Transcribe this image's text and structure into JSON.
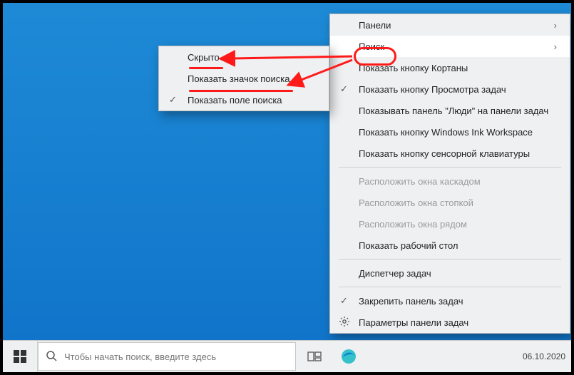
{
  "taskbar": {
    "search_placeholder": "Чтобы начать поиск, введите здесь",
    "date": "06.10.2020"
  },
  "main_menu": {
    "items": [
      {
        "label": "Панели",
        "arrow": true
      },
      {
        "label": "Поиск",
        "arrow": true,
        "hover": true
      },
      {
        "label": "Показать кнопку Кортаны"
      },
      {
        "label": "Показать кнопку Просмотра задач",
        "checked": true
      },
      {
        "label": "Показывать панель \"Люди\" на панели задач"
      },
      {
        "label": "Показать кнопку Windows Ink Workspace"
      },
      {
        "label": "Показать кнопку сенсорной клавиатуры"
      },
      {
        "sep": true
      },
      {
        "label": "Расположить окна каскадом",
        "disabled": true
      },
      {
        "label": "Расположить окна стопкой",
        "disabled": true
      },
      {
        "label": "Расположить окна рядом",
        "disabled": true
      },
      {
        "label": "Показать рабочий стол"
      },
      {
        "sep": true
      },
      {
        "label": "Диспетчер задач"
      },
      {
        "sep": true
      },
      {
        "label": "Закрепить панель задач",
        "checked": true
      },
      {
        "label": "Параметры панели задач",
        "gear": true
      }
    ]
  },
  "sub_menu": {
    "items": [
      {
        "label": "Скрыто"
      },
      {
        "label": "Показать значок поиска"
      },
      {
        "label": "Показать поле поиска",
        "checked": true
      }
    ]
  }
}
